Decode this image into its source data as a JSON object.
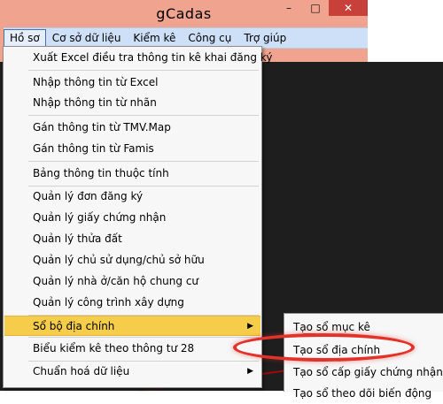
{
  "window": {
    "title": "gCadas",
    "controls": {
      "minimize": "–",
      "maximize": "□",
      "close": "✕"
    }
  },
  "menubar": {
    "items": [
      {
        "label": "Hồ sơ"
      },
      {
        "label": "Cơ sở dữ liệu"
      },
      {
        "label": "Kiểm kê"
      },
      {
        "label": "Công cụ"
      },
      {
        "label": "Trợ giúp"
      }
    ]
  },
  "dropdown": {
    "items": [
      {
        "label": "Xuất Excel điều tra thông tin kê khai đăng ký"
      },
      {
        "label": "Nhập thông tin từ Excel"
      },
      {
        "label": "Nhập thông tin từ nhãn"
      },
      {
        "label": "Gán thông tin từ TMV.Map"
      },
      {
        "label": "Gán thông tin từ Famis"
      },
      {
        "label": "Bảng thông tin thuộc tính"
      },
      {
        "label": "Quản lý đơn đăng ký"
      },
      {
        "label": "Quản lý giấy chứng nhận"
      },
      {
        "label": "Quản lý thửa đất"
      },
      {
        "label": "Quản lý chủ sử dụng/chủ sở hữu"
      },
      {
        "label": "Quản lý nhà ở/căn hộ chung cư"
      },
      {
        "label": "Quản lý công trình xây dựng"
      },
      {
        "label": "Sổ bộ địa chính",
        "submenu_arrow": "▶"
      },
      {
        "label": "Biểu kiểm kê theo thông tư 28"
      },
      {
        "label": "Chuẩn hoá dữ liệu",
        "submenu_arrow": "▶"
      }
    ]
  },
  "submenu": {
    "items": [
      {
        "label": "Tạo sổ mục kê"
      },
      {
        "label": "Tạo sổ địa chính"
      },
      {
        "label": "Tạo sổ cấp giấy chứng nhận"
      },
      {
        "label": "Tạo sổ theo dõi biến động"
      }
    ]
  },
  "colors": {
    "title_frame": "#f0a48f",
    "menubar": "#cde0f7",
    "highlight": "#f6cd4a",
    "annotation": "#e2332b"
  }
}
